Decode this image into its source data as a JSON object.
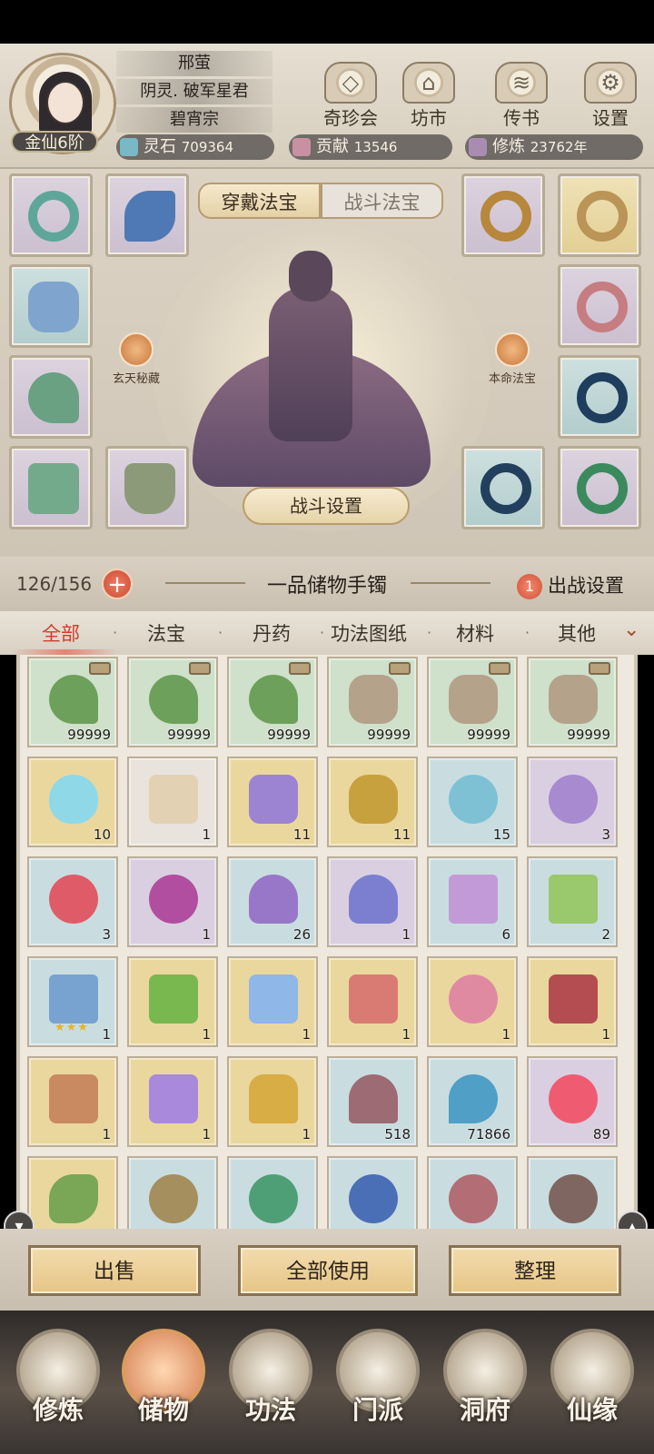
{
  "player": {
    "name": "邢萤",
    "title": "阴灵. 破军星君",
    "sect": "碧宵宗",
    "rank": "金仙6阶"
  },
  "resources": {
    "spirit_stone_label": "灵石",
    "spirit_stone_value": "709364",
    "contribution_label": "贡献",
    "contribution_value": "13546",
    "cultivation_label": "修炼",
    "cultivation_value": "23762年"
  },
  "top_buttons": [
    "奇珍会",
    "坊市",
    "传书",
    "设置"
  ],
  "equipment": {
    "tab_active": "穿戴法宝",
    "tab_inactive": "战斗法宝",
    "left_badge": "玄天秘藏",
    "right_badge": "本命法宝",
    "fight_settings": "战斗设置"
  },
  "bag": {
    "count": "126/156",
    "title": "一品储物手镯",
    "sortie_badge": "1",
    "sortie_label": "出战设置"
  },
  "categories": [
    "全部",
    "法宝",
    "丹药",
    "功法图纸",
    "材料",
    "其他"
  ],
  "category_separator": "·",
  "grid": {
    "row1": [
      "99999",
      "99999",
      "99999",
      "99999",
      "99999",
      "99999"
    ],
    "row2": [
      "10",
      "1",
      "11",
      "11",
      "15",
      "3"
    ],
    "row3": [
      "3",
      "1",
      "26",
      "1",
      "6",
      "2"
    ],
    "row4": [
      "1",
      "1",
      "1",
      "1",
      "1",
      "1"
    ],
    "row5": [
      "1",
      "1",
      "1",
      "518",
      "71866",
      "89"
    ]
  },
  "actions": {
    "sell": "出售",
    "use_all": "全部使用",
    "sort": "整理"
  },
  "nav": [
    "修炼",
    "储物",
    "功法",
    "门派",
    "洞府",
    "仙缘"
  ],
  "colors": {
    "accent_red": "#cf3d2d",
    "button_gold": "#e6c585",
    "green_slot": "#b9d2bd",
    "blue_slot": "#b2cdcc",
    "purple_slot": "#cbbfd0",
    "gold_slot": "#e3cf95"
  },
  "icons": {
    "top": [
      "pavilion-icon",
      "market-gate-icon",
      "scroll-icon",
      "gear-icon"
    ],
    "nav": [
      "meditation-icon",
      "storage-bag-icon",
      "technique-book-icon",
      "sect-gate-icon",
      "mountain-cave-icon",
      "yin-yang-icon"
    ]
  }
}
